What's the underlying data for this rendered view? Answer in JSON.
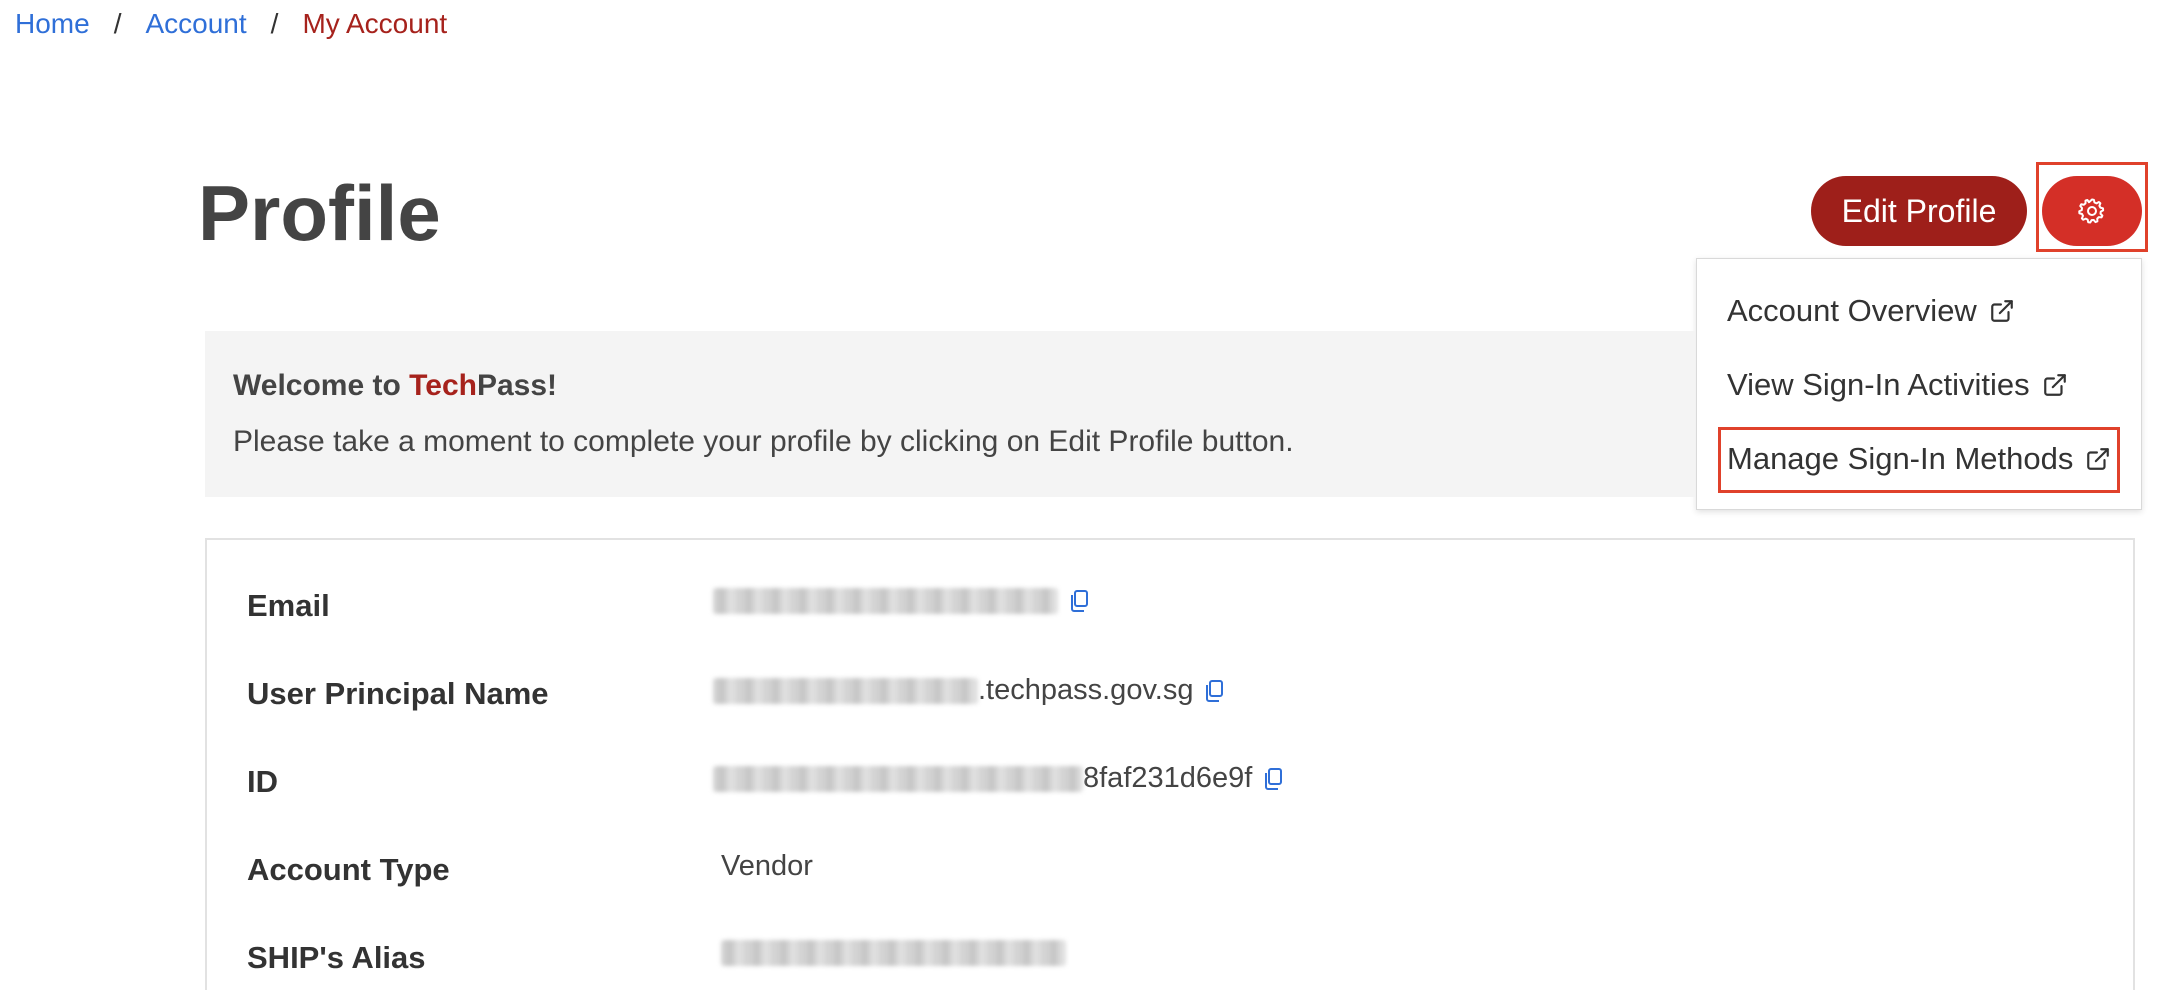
{
  "breadcrumb": {
    "home": "Home",
    "account": "Account",
    "current": "My Account",
    "separator": "/"
  },
  "header": {
    "title": "Profile",
    "edit_button": "Edit Profile",
    "settings_icon": "gear-icon"
  },
  "dropdown": {
    "items": [
      {
        "label": "Account Overview",
        "icon": "external-link-icon"
      },
      {
        "label": "View Sign-In Activities",
        "icon": "external-link-icon"
      },
      {
        "label": "Manage Sign-In Methods",
        "icon": "external-link-icon"
      }
    ]
  },
  "welcome": {
    "prefix": "Welcome to ",
    "brand_accent": "Tech",
    "brand_rest": "Pass!",
    "message": "Please take a moment to complete your profile by clicking on Edit Profile button."
  },
  "profile": {
    "rows": [
      {
        "label": "Email",
        "value_suffix": ""
      },
      {
        "label": "User Principal Name",
        "value_suffix": ".techpass.gov.sg"
      },
      {
        "label": "ID",
        "value_suffix": "8faf231d6e9f"
      },
      {
        "label": "Account Type",
        "value_suffix": "Vendor"
      },
      {
        "label": "SHIP's Alias",
        "value_suffix": ""
      }
    ]
  },
  "colors": {
    "link": "#2f6fd8",
    "brand_red": "#a6221c",
    "edit_button": "#9e1f1a",
    "gear_button": "#d42f27",
    "highlight": "#e0412b"
  }
}
